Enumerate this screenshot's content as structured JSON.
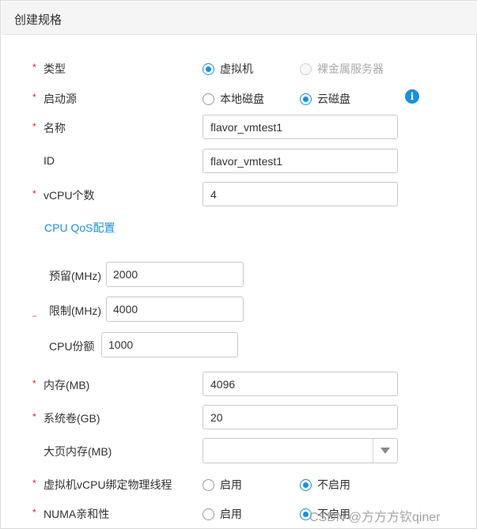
{
  "header": {
    "title": "创建规格"
  },
  "required_mark": "*",
  "type_row": {
    "label": "类型",
    "options": [
      {
        "label": "虚拟机",
        "selected": true,
        "disabled": false
      },
      {
        "label": "裸金属服务器",
        "selected": false,
        "disabled": true
      }
    ]
  },
  "boot_row": {
    "label": "启动源",
    "options": [
      {
        "label": "本地磁盘",
        "selected": false
      },
      {
        "label": "云磁盘",
        "selected": true
      }
    ],
    "info_icon": "info-icon",
    "info_glyph": "i"
  },
  "name_row": {
    "label": "名称",
    "value": "flavor_vmtest1"
  },
  "id_row": {
    "label": "ID",
    "value": "flavor_vmtest1"
  },
  "vcpu_row": {
    "label": "vCPU个数",
    "value": "4"
  },
  "qos": {
    "link": "CPU QoS配置",
    "reserve": {
      "label": "预留(MHz)",
      "value": "2000"
    },
    "limit": {
      "label": "限制(MHz)",
      "value": "4000"
    },
    "shares": {
      "label": "CPU份额",
      "value": "1000"
    }
  },
  "memory_row": {
    "label": "内存(MB)",
    "value": "4096"
  },
  "sysdisk_row": {
    "label": "系统卷(GB)",
    "value": "20"
  },
  "hugepage_row": {
    "label": "大页内存(MB)",
    "value": ""
  },
  "vcpu_bind_row": {
    "label": "虚拟机vCPU绑定物理线程",
    "options": [
      {
        "label": "启用",
        "selected": false
      },
      {
        "label": "不启用",
        "selected": true
      }
    ]
  },
  "numa_row": {
    "label": "NUMA亲和性",
    "options": [
      {
        "label": "启用",
        "selected": false
      },
      {
        "label": "不启用",
        "selected": true
      }
    ]
  },
  "watermark": "CSDN @方方方钦qiner",
  "colors": {
    "accent": "#1a8fe0",
    "required": "#e2231a",
    "header_bg": "#f5f5f5"
  }
}
